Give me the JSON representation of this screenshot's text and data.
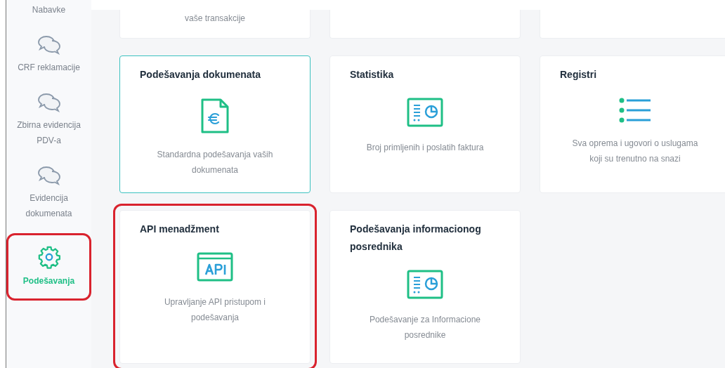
{
  "sidebar": {
    "items": [
      {
        "label": "Nabavke",
        "kind": "plain",
        "selected": false,
        "highlighted": false
      },
      {
        "label": "CRF reklamacije",
        "kind": "chat",
        "selected": false,
        "highlighted": false
      },
      {
        "label": "Zbirna evidencija PDV-a",
        "kind": "chat",
        "selected": false,
        "highlighted": false
      },
      {
        "label": "Evidencija dokumenata",
        "kind": "chat",
        "selected": false,
        "highlighted": false
      },
      {
        "label": "Podešavanja",
        "kind": "gear",
        "selected": true,
        "highlighted": true
      }
    ]
  },
  "cards": [
    {
      "kind": "partial",
      "description": "vaše transakcije",
      "selected": false
    },
    {
      "kind": "partial",
      "selected": false
    },
    {
      "kind": "partial",
      "selected": false
    },
    {
      "kind": "euro-document",
      "title": "Podešavanja dokumenata",
      "description": "Standardna podešavanja vaših dokumenata",
      "selected": true,
      "highlighted": false
    },
    {
      "kind": "statistics",
      "title": "Statistika",
      "description": "Broj primljenih i poslatih faktura",
      "selected": false,
      "highlighted": false
    },
    {
      "kind": "list",
      "title": "Registri",
      "description": "Sva oprema i ugovori o uslugama koji su trenutno na snazi",
      "selected": false,
      "highlighted": false
    },
    {
      "kind": "api",
      "title": "API menadžment",
      "description": "Upravljanje API pristupom i podešavanja",
      "selected": false,
      "highlighted": true
    },
    {
      "kind": "statistics",
      "title": "Podešavanja informacionog posrednika",
      "description": "Podešavanje za Informacione posrednike",
      "selected": false,
      "highlighted": false
    }
  ]
}
